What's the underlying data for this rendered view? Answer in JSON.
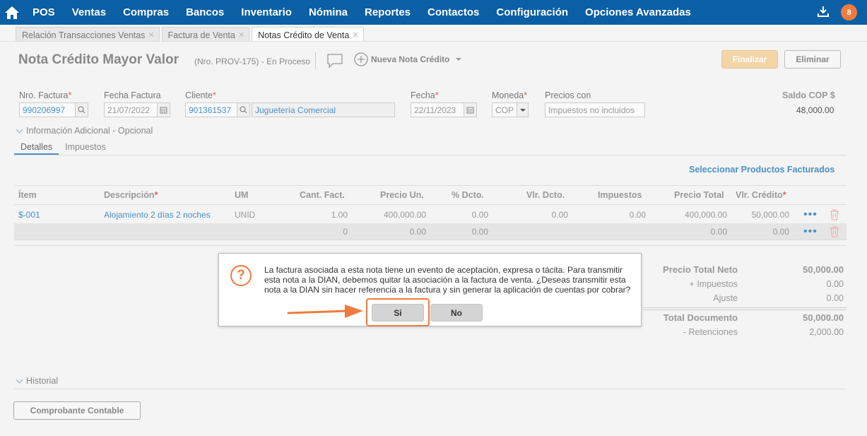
{
  "nav": {
    "items": [
      "POS",
      "Ventas",
      "Compras",
      "Bancos",
      "Inventario",
      "Nómina",
      "Reportes",
      "Contactos",
      "Configuración",
      "Opciones Avanzadas"
    ],
    "badge": "8"
  },
  "tabs": [
    "Relación Transacciones Ventas",
    "Factura de Venta",
    "Notas Crédito de Venta"
  ],
  "header": {
    "title": "Nota Crédito Mayor Valor",
    "subtitle": "(Nro. PROV-175) - En Proceso",
    "new_note": "Nueva Nota Crédito",
    "finalize": "Finalizar",
    "delete": "Eliminar"
  },
  "form": {
    "nro_factura_label": "Nro. Factura",
    "nro_factura": "990206997",
    "fecha_factura_label": "Fecha Factura",
    "fecha_factura": "21/07/2022",
    "cliente_label": "Cliente",
    "cliente_id": "901361537",
    "cliente_nombre": "Juguetería Comercial",
    "fecha_label": "Fecha",
    "fecha": "22/11/2023",
    "moneda_label": "Moneda",
    "moneda": "COP",
    "precios_label": "Precios con",
    "precios": "Impuestos no incluidos",
    "saldo_label": "Saldo COP $",
    "saldo": "48,000.00"
  },
  "info_adicional": "Información Adicional - Opcional",
  "subtabs": [
    "Detalles",
    "Impuestos"
  ],
  "select_products": "Seleccionar Productos Facturados",
  "table": {
    "headers": [
      "Ítem",
      "Descripción",
      "UM",
      "Cant. Fact.",
      "Precio Un.",
      "% Dcto.",
      "Vlr. Dcto.",
      "Impuestos",
      "Precio Total",
      "Vlr. Crédito"
    ],
    "row1": [
      "$-001",
      "Alojamiento 2 días 2 noches",
      "UNID",
      "1.00",
      "400,000.00",
      "0.00",
      "0.00",
      "0.00",
      "400,000.00",
      "50,000.00"
    ],
    "row2": [
      "0",
      "0.00",
      "0.00",
      "0.00",
      "0.00"
    ]
  },
  "totals": {
    "neto_label": "Precio Total Neto",
    "neto": "50,000.00",
    "impuestos_label": "+ Impuestos",
    "impuestos": "0.00",
    "ajuste_label": "Ajuste",
    "ajuste": "0.00",
    "total_label": "Total Documento",
    "total": "50,000.00",
    "retenciones_label": "- Retenciones",
    "retenciones": "2,000.00"
  },
  "historial": "Historial",
  "comprobante": "Comprobante Contable",
  "dialog": {
    "message": "La factura asociada a esta nota tiene un evento de aceptación, expresa o tácita. Para transmitir esta nota a la DIAN, debemos quitar la asociación a la factura de venta. ¿Deseas transmitir esta nota a la DIAN sin hacer referencia a la factura y sin generar la aplicación de cuentas por cobrar?",
    "yes": "Si",
    "no": "No"
  }
}
